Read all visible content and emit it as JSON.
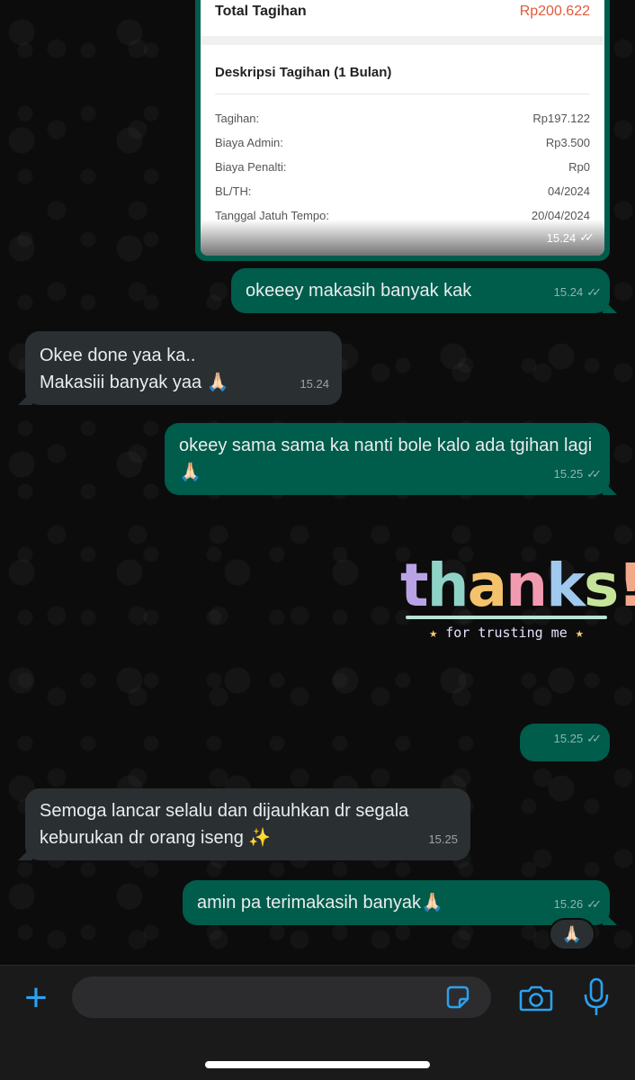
{
  "bill": {
    "total_label": "Total Tagihan",
    "total_value": "Rp200.622",
    "desc_title": "Deskripsi Tagihan (1 Bulan)",
    "items": [
      {
        "label": "Tagihan:",
        "value": "Rp197.122"
      },
      {
        "label": "Biaya Admin:",
        "value": "Rp3.500"
      },
      {
        "label": "Biaya Penalti:",
        "value": "Rp0"
      },
      {
        "label": "BL/TH:",
        "value": "04/2024"
      },
      {
        "label": "Tanggal Jatuh Tempo:",
        "value": "20/04/2024"
      }
    ],
    "time": "15.24"
  },
  "messages": [
    {
      "dir": "out",
      "text": "okeeey makasih banyak kak",
      "time": "15.24"
    },
    {
      "dir": "in",
      "text": "Okee done yaa ka..\nMakasiii banyak yaa 🙏🏻",
      "time": "15.24"
    },
    {
      "dir": "out",
      "text": "okeey sama sama ka nanti bole kalo ada tgihan lagi🙏🏻",
      "time": "15.25"
    },
    {
      "dir": "out",
      "text": "",
      "time": "15.25"
    },
    {
      "dir": "in",
      "text": "Semoga lancar selalu dan dijauhkan dr segala keburukan dr orang iseng ✨",
      "time": "15.25"
    },
    {
      "dir": "out",
      "text": "amin pa terimakasih banyak🙏🏻",
      "time": "15.26"
    }
  ],
  "sticker": {
    "title": "thanks!",
    "subtitle": "for trusting me",
    "star": "★"
  },
  "reaction": "🙏🏻",
  "check_icon": "✓✓",
  "input": {
    "placeholder": ""
  },
  "colors": {
    "outgoing": "#005c4b",
    "incoming": "#2a2f32",
    "accent": "#2aa2f0",
    "total": "#e05a3a"
  }
}
